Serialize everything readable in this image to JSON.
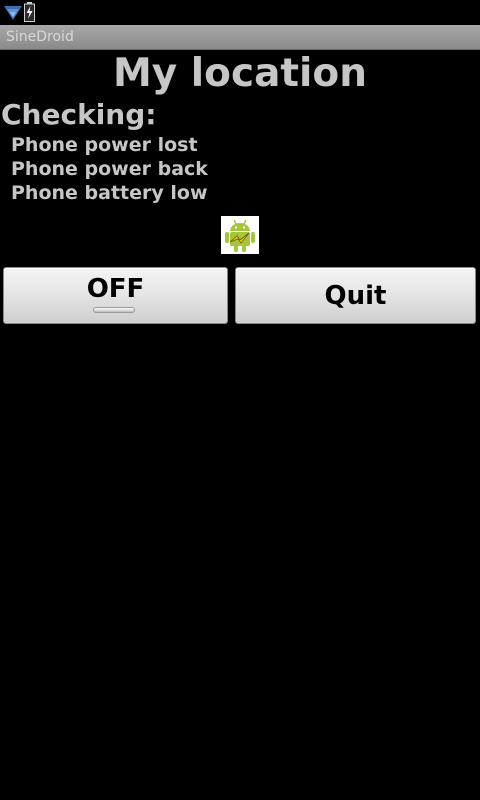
{
  "status_bar": {
    "icons": [
      "wifi-icon",
      "battery-charging-icon"
    ]
  },
  "app": {
    "title": "SineDroid"
  },
  "main": {
    "heading": "My location",
    "checking_label": "Checking:",
    "checks": [
      "Phone power lost",
      "Phone power back",
      "Phone battery low"
    ],
    "logo_icon": "android-charging-icon"
  },
  "buttons": {
    "toggle_label": "OFF",
    "toggle_state": "off",
    "quit_label": "Quit"
  },
  "colors": {
    "background": "#000000",
    "text": "#c6c6c6",
    "title_bar": "#999999",
    "android_green": "#a4c639",
    "bolt_yellow": "#f6d400"
  }
}
